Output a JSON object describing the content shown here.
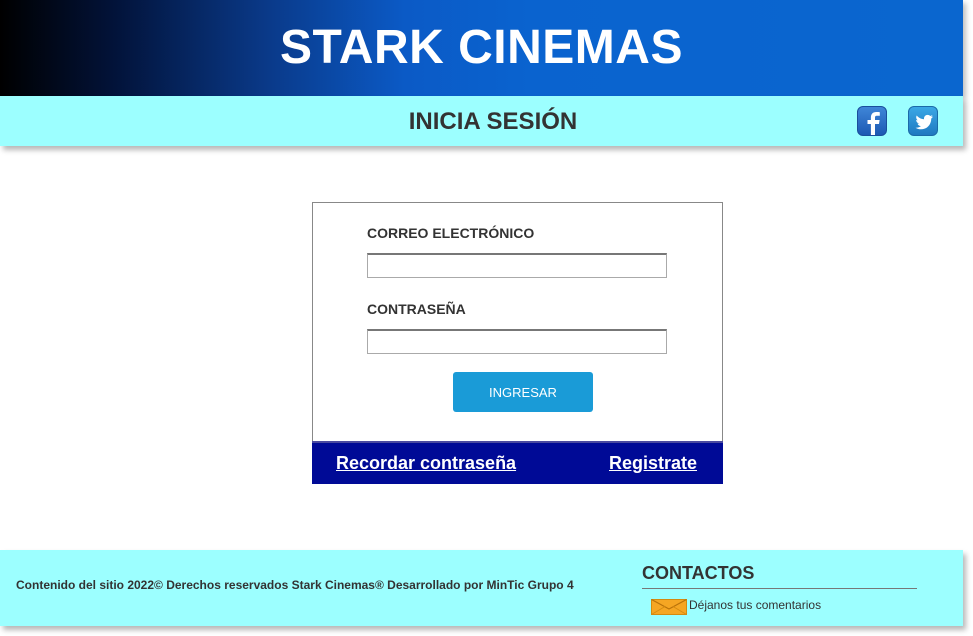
{
  "header": {
    "brand": "STARK CINEMAS",
    "subtitle": "INICIA SESIÓN",
    "social": [
      "facebook-icon",
      "twitter-icon"
    ]
  },
  "login": {
    "email_label": "CORREO ELECTRÓNICO",
    "email_value": "",
    "password_label": "CONTRASEÑA",
    "password_value": "",
    "submit_label": "INGRESAR",
    "recover_link": "Recordar contraseña",
    "register_link": "Registrate"
  },
  "footer": {
    "copyright": "Contenido del sitio 2022© Derechos reservados Stark Cinemas® Desarrollado por MinTic Grupo 4",
    "contacts_title": "CONTACTOS",
    "comments_label": "Déjanos tus comentarios"
  },
  "colors": {
    "header_blue": "#0a66cf",
    "bar_cyan": "#9cffff",
    "button_blue": "#1a9bd7",
    "card_footer_navy": "#000a96"
  }
}
